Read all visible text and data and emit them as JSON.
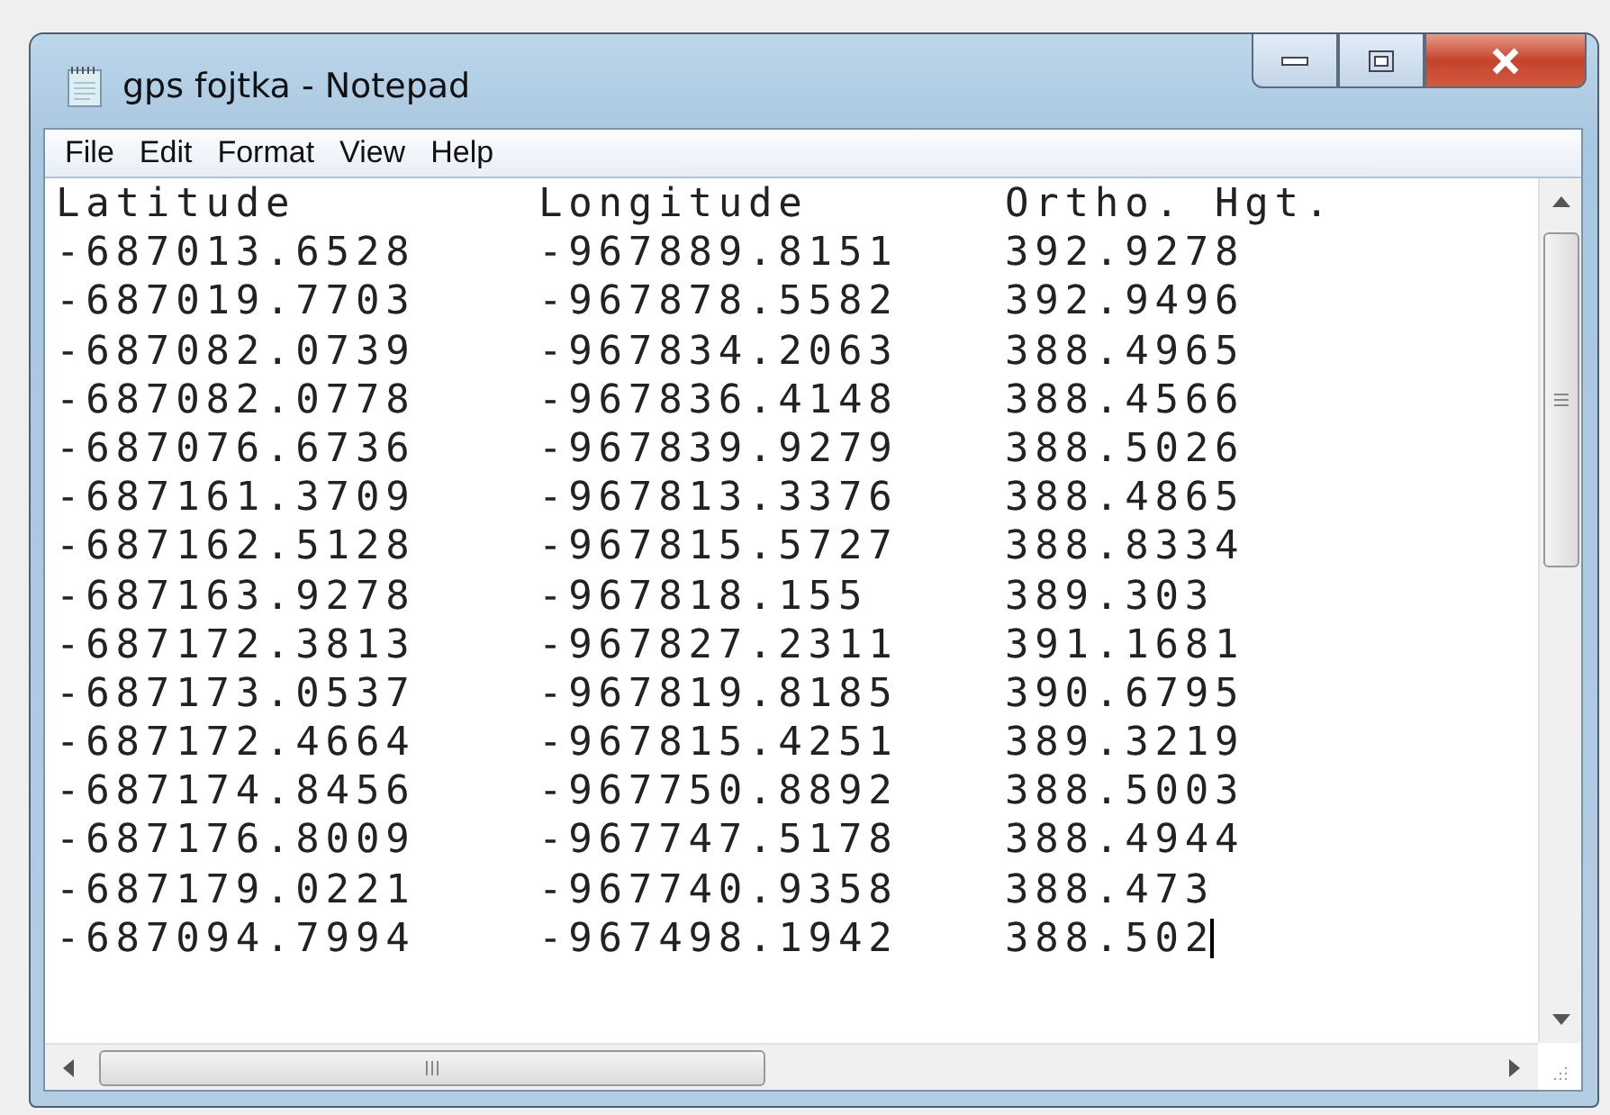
{
  "window": {
    "title": "gps fojtka - Notepad"
  },
  "menu": [
    "File",
    "Edit",
    "Format",
    "View",
    "Help"
  ],
  "header": [
    "Latitude",
    "Longitude",
    "Ortho. Hgt."
  ],
  "rows": [
    [
      "-687013.6528",
      "-967889.8151",
      "392.9278"
    ],
    [
      "-687019.7703",
      "-967878.5582",
      "392.9496"
    ],
    [
      "-687082.0739",
      "-967834.2063",
      "388.4965"
    ],
    [
      "-687082.0778",
      "-967836.4148",
      "388.4566"
    ],
    [
      "-687076.6736",
      "-967839.9279",
      "388.5026"
    ],
    [
      "-687161.3709",
      "-967813.3376",
      "388.4865"
    ],
    [
      "-687162.5128",
      "-967815.5727",
      "388.8334"
    ],
    [
      "-687163.9278",
      "-967818.155",
      "389.303"
    ],
    [
      "-687172.3813",
      "-967827.2311",
      "391.1681"
    ],
    [
      "-687173.0537",
      "-967819.8185",
      "390.6795"
    ],
    [
      "-687172.4664",
      "-967815.4251",
      "389.3219"
    ],
    [
      "-687174.8456",
      "-967750.8892",
      "388.5003"
    ],
    [
      "-687176.8009",
      "-967747.5178",
      "388.4944"
    ],
    [
      "-687179.0221",
      "-967740.9358",
      "388.473"
    ],
    [
      "-687094.7994",
      "-967498.1942",
      "388.502"
    ]
  ]
}
